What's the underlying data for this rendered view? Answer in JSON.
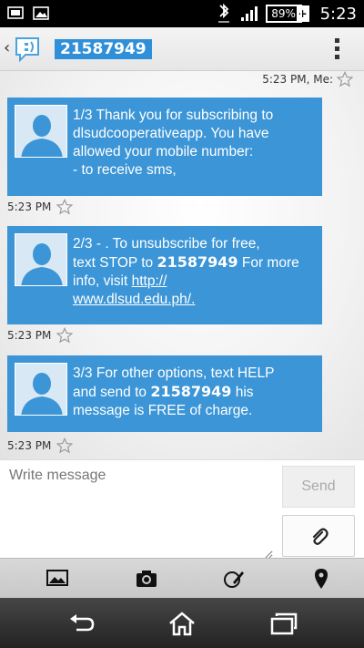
{
  "status_bar": {
    "battery": "89%",
    "battery_charging": "+",
    "time": "5:23"
  },
  "header": {
    "contact": "21587949"
  },
  "conversation": {
    "sent_meta": "5:23 PM, Me:",
    "messages": [
      {
        "line1": "1/3 Thank you for subscribing to",
        "line2": "dlsudcooperativeapp. You have",
        "line3": "allowed your mobile number:",
        "line4": "- to receive sms,",
        "time": "5:23 PM"
      },
      {
        "line1": "2/3 - . To unsubscribe for free,",
        "line2_pre": "text STOP to",
        "line2_num": "21587949",
        "line2_post": "For more",
        "line3_pre": "info, visit ",
        "line3_link": "http://",
        "line4_link": "www.dlsud.edu.ph/.",
        "time": "5:23 PM"
      },
      {
        "line1": "3/3 For other options, text HELP",
        "line2_pre": "and send to",
        "line2_num": "21587949",
        "line2_post": "his",
        "line3": "message is FREE of charge.",
        "time": "5:23 PM"
      }
    ]
  },
  "compose": {
    "placeholder": "Write message",
    "send_label": "Send"
  }
}
